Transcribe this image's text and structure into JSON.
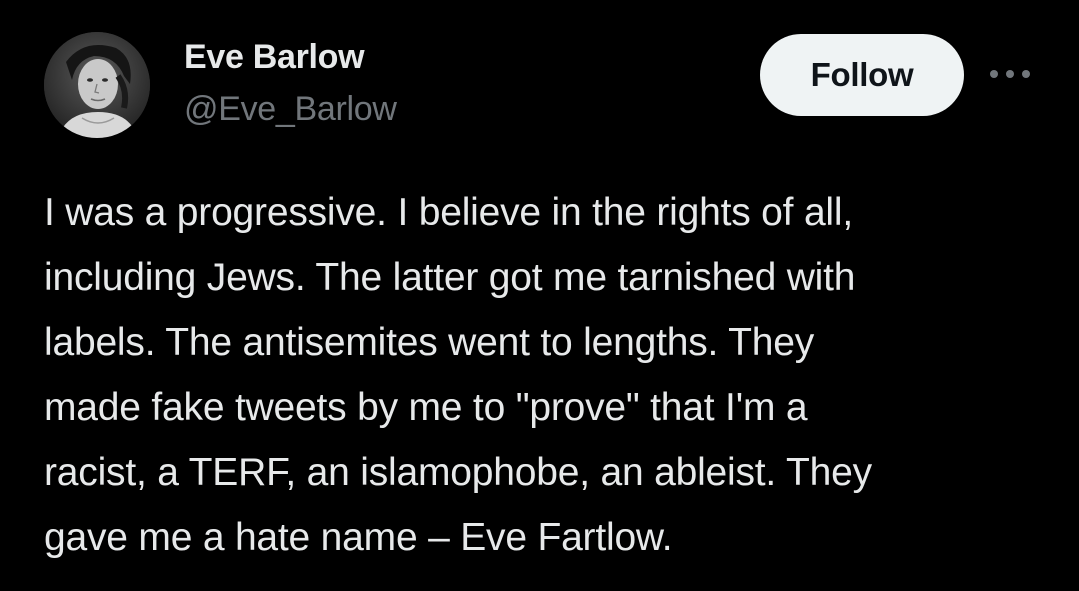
{
  "tweet": {
    "author": {
      "display_name": "Eve Barlow",
      "handle": "@Eve_Barlow",
      "avatar_icon": "avatar-photo"
    },
    "follow_label": "Follow",
    "more_icon": "more-options-icon",
    "lines": [
      "I was a progressive. I believe in the rights of all,",
      "including Jews. The latter got me tarnished with",
      "labels. The antisemites went to lengths. They",
      "made fake tweets by me to \"prove\" that I'm a",
      "racist, a TERF, an islamophobe, an ableist. They",
      "gave me a hate name – Eve Fartlow."
    ]
  },
  "colors": {
    "background": "#000000",
    "primary_text": "#e7e9ea",
    "secondary_text": "#71767b",
    "follow_bg": "#eff3f4",
    "follow_text": "#0f1419"
  }
}
